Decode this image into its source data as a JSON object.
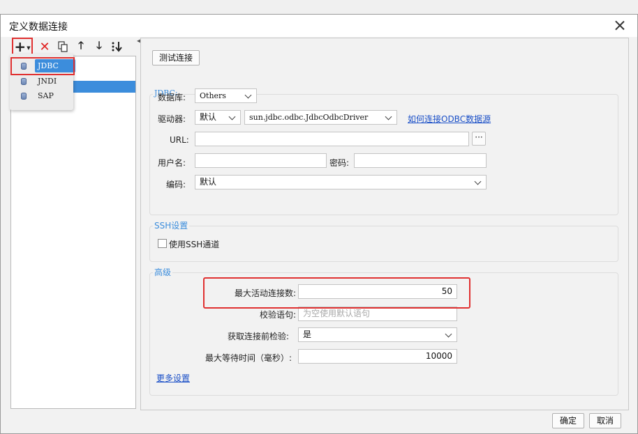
{
  "dialog": {
    "title": "定义数据连接"
  },
  "menu": {
    "items": [
      "JDBC",
      "JNDI",
      "SAP"
    ]
  },
  "buttons": {
    "test_connection": "测试连接",
    "ok": "确定",
    "cancel": "取消",
    "browse": "···"
  },
  "jdbc": {
    "legend": "JDBC:",
    "database_label": "数据库:",
    "database_value": "Others",
    "driver_label": "驱动器:",
    "driver_mode_value": "默认",
    "driver_class_value": "sun.jdbc.odbc.JdbcOdbcDriver",
    "odbc_link": "如何连接ODBC数据源",
    "url_label": "URL:",
    "url_value": "",
    "username_label": "用户名:",
    "username_value": "",
    "password_label": "密码:",
    "password_value": "",
    "encoding_label": "编码:",
    "encoding_value": "默认"
  },
  "ssh": {
    "legend": "SSH设置",
    "use_ssh_label": "使用SSH通道",
    "use_ssh_checked": false
  },
  "advanced": {
    "legend": "高级",
    "max_active_label": "最大活动连接数:",
    "max_active_value": "50",
    "validation_label": "校验语句:",
    "validation_placeholder": "为空使用默认语句",
    "test_before_label": "获取连接前检验:",
    "test_before_value": "是",
    "max_wait_label": "最大等待时间（毫秒）:",
    "max_wait_value": "10000",
    "more_link": "更多设置"
  }
}
